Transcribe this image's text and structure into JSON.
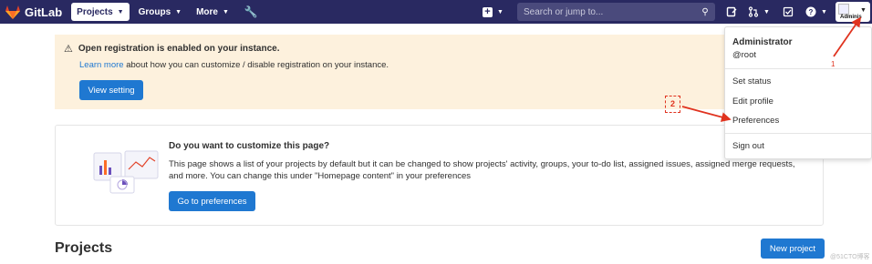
{
  "header": {
    "brand": "GitLab",
    "nav": [
      {
        "label": "Projects",
        "icon": "chevron-down-icon"
      },
      {
        "label": "Groups",
        "icon": "chevron-down-icon"
      },
      {
        "label": "More",
        "icon": "chevron-down-icon"
      }
    ],
    "search_placeholder": "Search or jump to...",
    "user_avatar_label": "Adminis",
    "colors": {
      "nav_bg": "#292961",
      "accent": "#1f78d1",
      "alert_bg": "#fdf1dd",
      "annotation": "#e0331f"
    }
  },
  "alert": {
    "title": "Open registration is enabled on your instance.",
    "link_text": "Learn more",
    "body": "about how you can customize / disable registration on your instance.",
    "button": "View setting"
  },
  "customize": {
    "title": "Do you want to customize this page?",
    "text": "This page shows a list of your projects by default but it can be changed to show projects' activity, groups, your to-do list, assigned issues, assigned merge requests, and more. You can change this under \"Homepage content\" in your preferences",
    "button": "Go to preferences"
  },
  "projects": {
    "heading": "Projects",
    "new_button": "New project"
  },
  "user_menu": {
    "name": "Administrator",
    "username": "@root",
    "items": [
      "Set status",
      "Edit profile",
      "Preferences",
      "Sign out"
    ]
  },
  "annotations": {
    "step1": "1",
    "step2": "2"
  },
  "watermark": "@51CTO博客"
}
